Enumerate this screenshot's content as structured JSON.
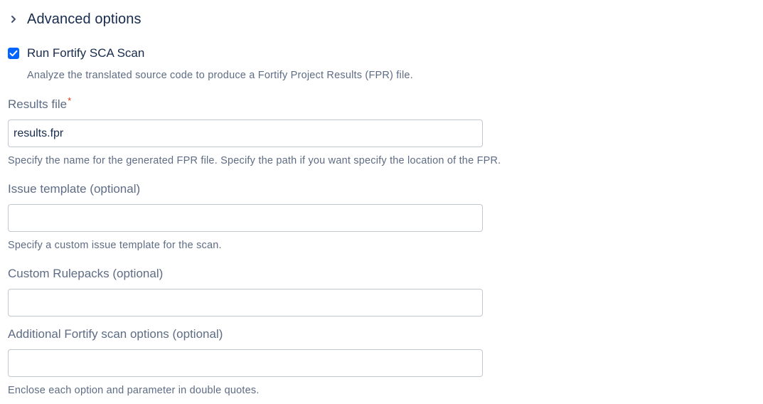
{
  "section": {
    "title": "Advanced options",
    "icon": "chevron-right-icon"
  },
  "run_scan": {
    "label": "Run Fortify SCA Scan",
    "checked": true,
    "description": "Analyze the translated source code to produce a Fortify Project Results (FPR) file.",
    "check_icon": "checkmark-icon",
    "accent_color": "#0065ff"
  },
  "results_file": {
    "label": "Results file",
    "required_mark": "*",
    "value": "results.fpr",
    "help": "Specify the name for the generated FPR file. Specify the path if you want specify the location of the FPR."
  },
  "issue_template": {
    "label": "Issue template (optional)",
    "value": "",
    "help": "Specify a custom issue template for the scan."
  },
  "custom_rulepacks": {
    "label": "Custom Rulepacks (optional)",
    "value": ""
  },
  "additional_options": {
    "label": "Additional Fortify scan options (optional)",
    "value": "",
    "help": "Enclose each option and parameter in double quotes."
  }
}
